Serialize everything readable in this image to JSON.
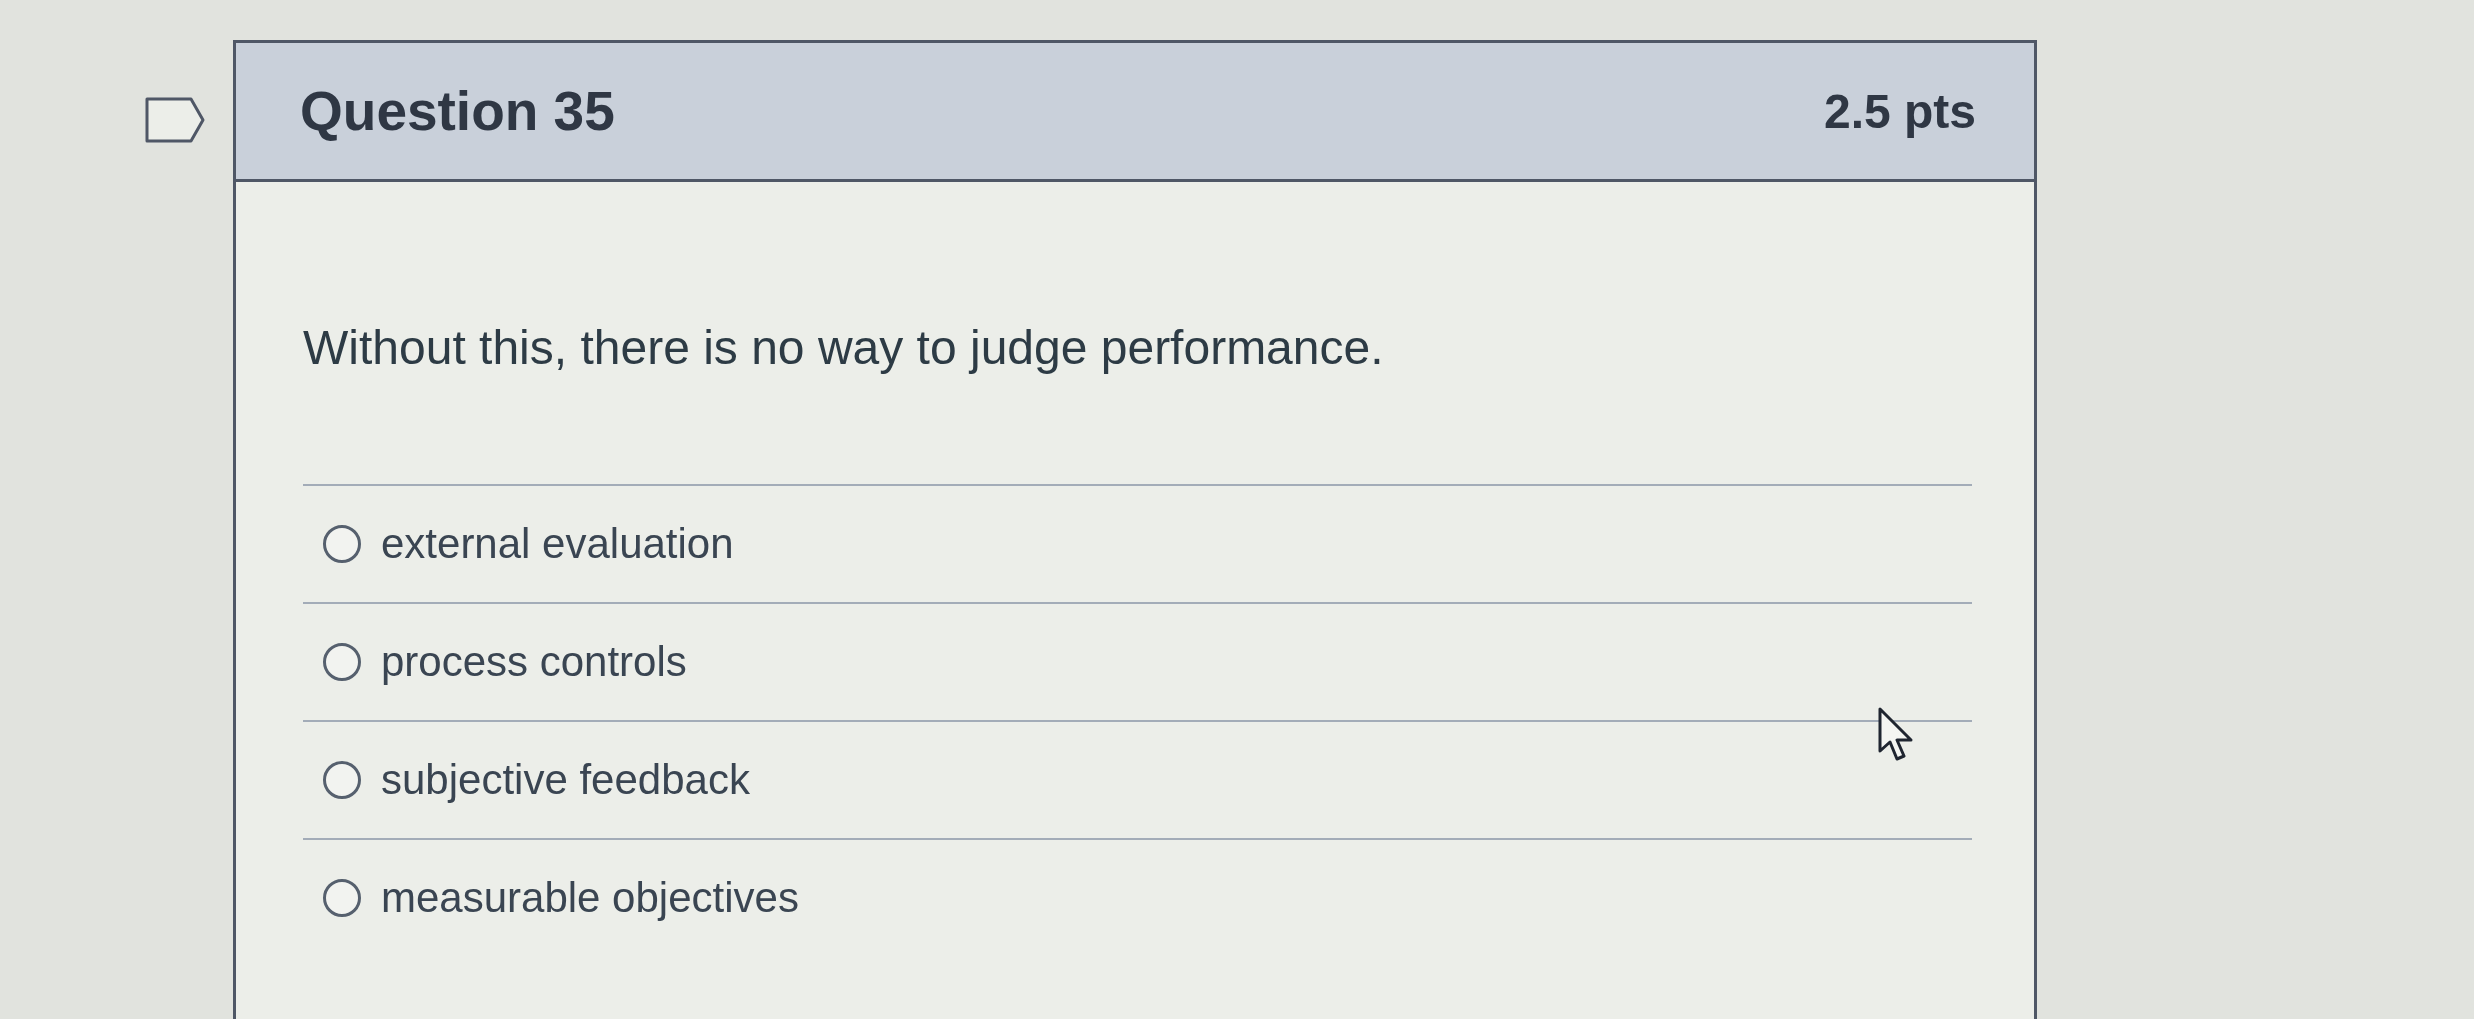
{
  "question": {
    "flagged": false,
    "title": "Question 35",
    "points": "2.5 pts",
    "text": "Without this, there is no way to judge performance.",
    "answers": [
      {
        "label": "external evaluation",
        "selected": false
      },
      {
        "label": "process controls",
        "selected": false
      },
      {
        "label": "subjective feedback",
        "selected": false
      },
      {
        "label": "measurable objectives",
        "selected": false
      }
    ]
  }
}
